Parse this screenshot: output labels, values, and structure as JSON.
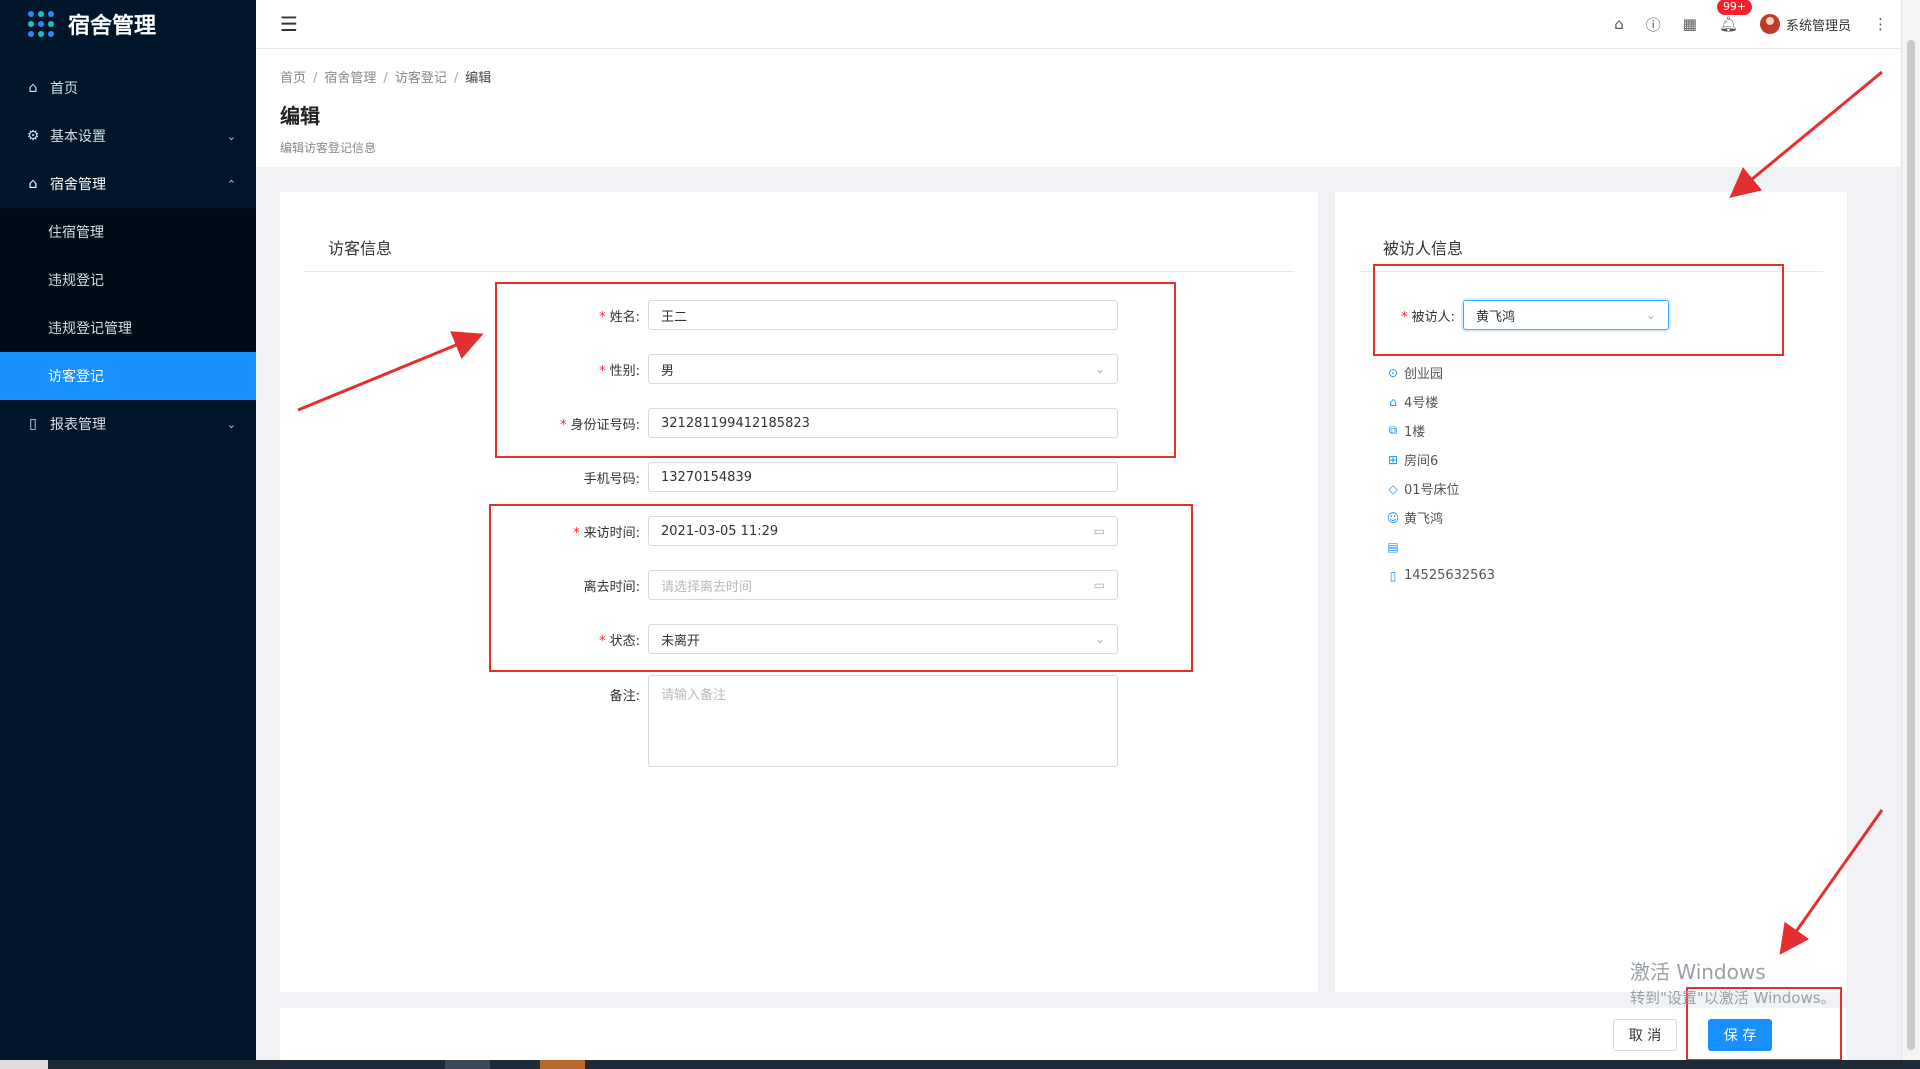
{
  "app": {
    "logo_text": "宿舍管理"
  },
  "sidebar": {
    "items": [
      {
        "label": "首页",
        "icon": "home-icon"
      },
      {
        "label": "基本设置",
        "icon": "gear-icon"
      },
      {
        "label": "宿舍管理",
        "icon": "home-icon"
      },
      {
        "label": "报表管理",
        "icon": "file-icon"
      }
    ],
    "sub_items": [
      {
        "label": "住宿管理"
      },
      {
        "label": "违规登记"
      },
      {
        "label": "违规登记管理"
      },
      {
        "label": "访客登记"
      }
    ]
  },
  "header": {
    "badge": "99+",
    "user_name": "系统管理员"
  },
  "breadcrumb": [
    "首页",
    "宿舍管理",
    "访客登记",
    "编辑"
  ],
  "page": {
    "title": "编辑",
    "description": "编辑访客登记信息"
  },
  "visitor_form": {
    "title": "访客信息",
    "name_label": "姓名:",
    "name_value": "王二",
    "gender_label": "性别:",
    "gender_value": "男",
    "id_label": "身份证号码:",
    "id_value": "321281199412185823",
    "phone_label": "手机号码:",
    "phone_value": "13270154839",
    "visit_time_label": "来访时间:",
    "visit_time_value": "2021-03-05 11:29",
    "leave_time_label": "离去时间:",
    "leave_time_placeholder": "请选择离去时间",
    "status_label": "状态:",
    "status_value": "未离开",
    "remark_label": "备注:",
    "remark_placeholder": "请输入备注"
  },
  "visited_form": {
    "title": "被访人信息",
    "visited_label": "被访人:",
    "visited_value": "黄飞鸿",
    "info": {
      "campus": "创业园",
      "building": "4号楼",
      "floor": "1楼",
      "room": "房间6",
      "bed": "01号床位",
      "person": "黄飞鸿",
      "phone": "14525632563"
    }
  },
  "footer": {
    "cancel_label": "取 消",
    "save_label": "保 存"
  },
  "watermark": {
    "line1": "激活 Windows",
    "line2": "转到\"设置\"以激活 Windows。"
  },
  "colors": {
    "sidebar_bg": "#001529",
    "accent": "#1890ff",
    "annotation_red": "#e32f2f"
  }
}
